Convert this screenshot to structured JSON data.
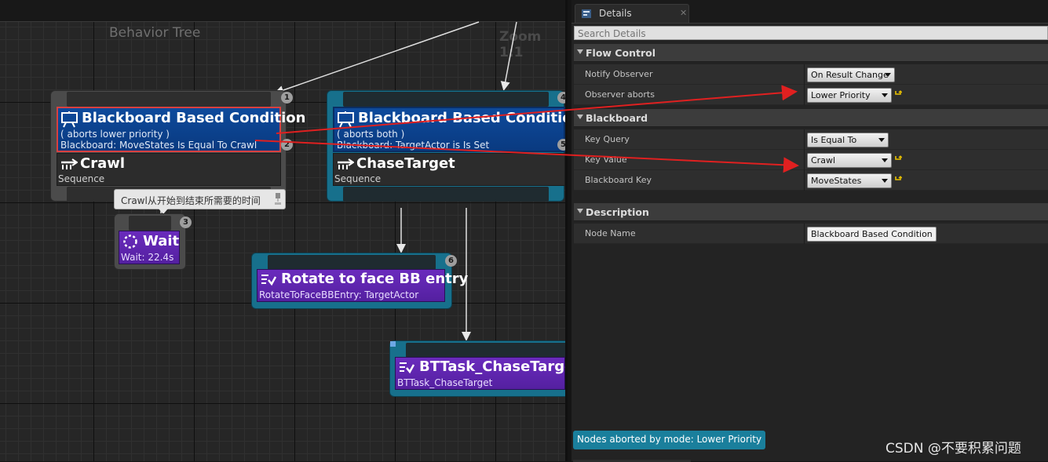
{
  "graph": {
    "title": "Behavior Tree",
    "zoom": "Zoom 1:1",
    "nodes": {
      "selector_left": {
        "index": "1",
        "decorator": {
          "title": "Blackboard Based Condition",
          "line1": "( aborts lower priority )",
          "line2": "Blackboard: MoveStates Is Equal To Crawl",
          "index": "2"
        },
        "composite": {
          "title": "Crawl",
          "sub": "Sequence"
        }
      },
      "selector_right": {
        "index": "4",
        "decorator": {
          "title": "Blackboard Based Condition",
          "line1": "( aborts both )",
          "line2": "Blackboard: TargetActor is Is Set",
          "index": "5"
        },
        "composite": {
          "title": "ChaseTarget",
          "sub": "Sequence"
        }
      },
      "wait": {
        "index": "3",
        "title": "Wait",
        "sub": "Wait: 22.4s"
      },
      "rotate": {
        "index": "6",
        "title": "Rotate to face BB entry",
        "sub": "RotateToFaceBBEntry: TargetActor"
      },
      "chase_task": {
        "title": "BTTask_ChaseTarget",
        "sub": "BTTask_ChaseTarget"
      }
    },
    "tooltip": "Crawl从开始到结束所需要的时间"
  },
  "details": {
    "tab_label": "Details",
    "search_placeholder": "Search Details",
    "categories": {
      "flow_control": {
        "label": "Flow Control",
        "notify_observer": {
          "label": "Notify Observer",
          "value": "On Result Change"
        },
        "observer_aborts": {
          "label": "Observer aborts",
          "value": "Lower Priority"
        }
      },
      "blackboard": {
        "label": "Blackboard",
        "key_query": {
          "label": "Key Query",
          "value": "Is Equal To"
        },
        "key_value": {
          "label": "Key Value",
          "value": "Crawl"
        },
        "blackboard_key": {
          "label": "Blackboard Key",
          "value": "MoveStates"
        }
      },
      "description": {
        "label": "Description",
        "node_name": {
          "label": "Node Name",
          "value": "Blackboard Based Condition"
        }
      }
    },
    "status": "Nodes aborted by mode: Lower Priority"
  },
  "watermark": "CSDN @不要积累问题",
  "colors": {
    "selection_red": "#d94040",
    "annotation_red": "#e02020",
    "teal_node": "#17708c",
    "blue_decorator": "#0d4a9c",
    "purple_task": "#6a2bbd",
    "status_teal": "#1a7f9c"
  },
  "icons": [
    "board-icon",
    "sequence-icon",
    "wait-icon",
    "task-icon",
    "reset-arrow-icon",
    "close-icon"
  ]
}
